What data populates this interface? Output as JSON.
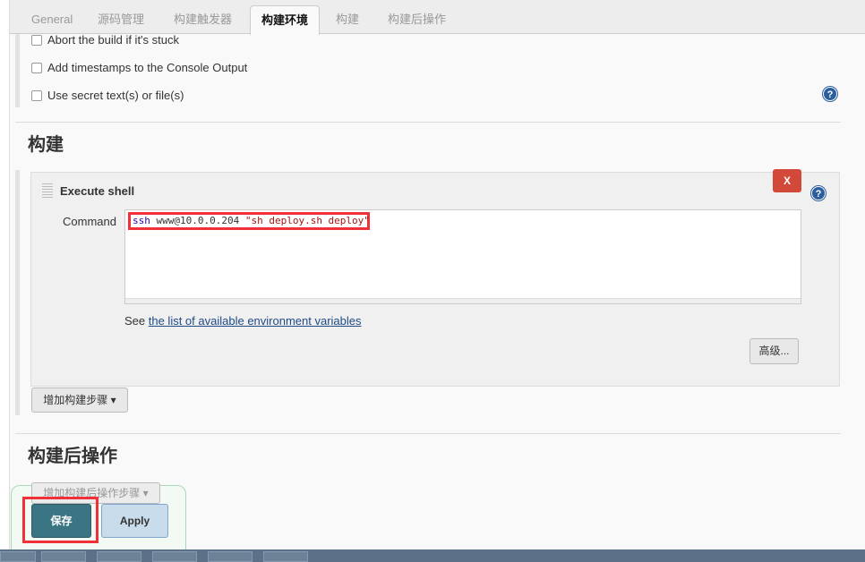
{
  "tabs": [
    "General",
    "源码管理",
    "构建触发器",
    "构建环境",
    "构建",
    "构建后操作"
  ],
  "active_tab": "构建环境",
  "env_options": [
    {
      "label": "Abort the build if it's stuck",
      "checked": false
    },
    {
      "label": "Add timestamps to the Console Output",
      "checked": false
    },
    {
      "label": "Use secret text(s) or file(s)",
      "checked": false
    }
  ],
  "help_icon": "?",
  "build": {
    "title": "构建",
    "step": {
      "title": "Execute shell",
      "delete_label": "X",
      "command_label": "Command",
      "command_keyword": "ssh",
      "command_plain": " www@10.0.0.204 ",
      "command_string": "\"sh deploy.sh deploy\"",
      "see_prefix": "See ",
      "see_link": "the list of available environment variables",
      "advanced_label": "高级..."
    },
    "add_step_label": "增加构建步骤"
  },
  "post_build": {
    "title": "构建后操作",
    "add_step_label": "增加构建后操作步骤"
  },
  "footer": {
    "save_label": "保存",
    "apply_label": "Apply"
  },
  "colors": {
    "save": "#3b7583",
    "apply": "#c9dcec",
    "highlight": "#f0313a",
    "delete": "#d24939",
    "link": "#204a87"
  }
}
